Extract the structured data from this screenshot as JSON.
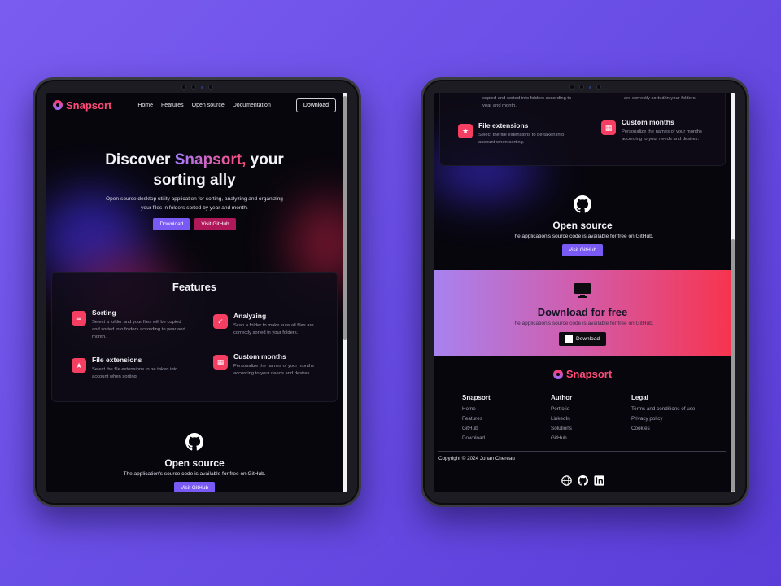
{
  "brand": {
    "name": "Snapsort"
  },
  "nav": {
    "links": [
      "Home",
      "Features",
      "Open source",
      "Documentation"
    ],
    "download_label": "Download"
  },
  "hero": {
    "title_before": "Discover ",
    "title_accent": "Snapsort,",
    "title_after": " your",
    "title_line2": "sorting ally",
    "subtitle": "Open-source desktop utility application for sorting, analyzing and organizing your files in folders sorted by year and month.",
    "download_label": "Download",
    "github_label": "Visit GitHub"
  },
  "features": {
    "title": "Features",
    "items": [
      {
        "icon": "sort-icon",
        "title": "Sorting",
        "desc": "Select a folder and your files will be copied and sorted into folders according to year and month."
      },
      {
        "icon": "folder-check-icon",
        "title": "Analyzing",
        "desc": "Scan a folder to make sure all files are correctly sorted in your folders."
      },
      {
        "icon": "file-star-icon",
        "title": "File extensions",
        "desc": "Select the file extensions to be taken into account when sorting."
      },
      {
        "icon": "calendar-icon",
        "title": "Custom months",
        "desc": "Personalize the names of your months according to your needs and desires."
      }
    ],
    "partial_desc_left": "copied and sorted into folders according to year and month.",
    "partial_desc_right": "are correctly sorted in your folders."
  },
  "open_source": {
    "title": "Open source",
    "subtitle": "The application's source code is available for free on GitHub.",
    "button": "Visit GitHub"
  },
  "download": {
    "title": "Download for free",
    "subtitle": "The application's source code is available for free on GitHub.",
    "button": "Download"
  },
  "footer": {
    "columns": [
      {
        "title": "Snapsort",
        "items": [
          "Home",
          "Features",
          "GitHub",
          "Download"
        ]
      },
      {
        "title": "Author",
        "items": [
          "Portfolio",
          "LinkedIn",
          "Solutions",
          "GitHub"
        ]
      },
      {
        "title": "Legal",
        "items": [
          "Terms and conditions of use",
          "Privacy policy",
          "Cookies"
        ]
      }
    ],
    "copyright": "Copyright © 2024 Johan Chereau"
  },
  "colors": {
    "accent_purple": "#7a5af5",
    "accent_pink": "#f43f62",
    "github_button": "#b0185a",
    "background": "#07060d"
  }
}
